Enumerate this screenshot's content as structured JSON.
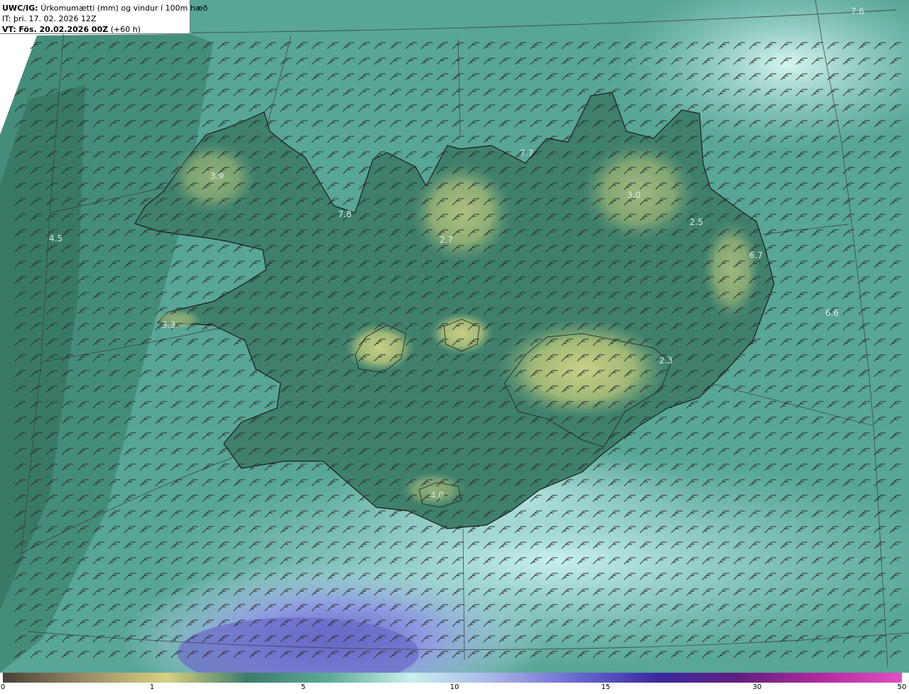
{
  "header": {
    "product": "UWC/IG:",
    "description": "Úrkomumætti (mm) og vindur í 100m hæð",
    "init_time": "IT: þri. 17. 02. 2026 12Z",
    "valid_prefix": "VT:",
    "valid_time": "Fös. 20.02.2026 00Z",
    "lead": "(+60 h)"
  },
  "map_values": [
    "3.9",
    "4.5",
    "3.3",
    "7.7",
    "7.8",
    "2.7",
    "3.0",
    "2.5",
    "6.7",
    "6.6",
    "2.3",
    "4.0",
    "7.6"
  ],
  "colorbar": {
    "ticks": [
      "0",
      "1",
      "5",
      "10",
      "15",
      "30",
      "50"
    ],
    "colors": [
      "#4a4038",
      "#9a8a64",
      "#d7d182",
      "#3c7a6a",
      "#5faa9a",
      "#c8f0ee",
      "#a8b4e8",
      "#6a6ad0",
      "#3a2aa0",
      "#602080",
      "#b02aa0",
      "#e050c0"
    ]
  },
  "colors": {
    "sea_base": "#5aa898",
    "land": "#3e7c68",
    "highland": "#b7c47a",
    "coast": "#1a1a1a",
    "graticule": "#3a3a3a",
    "barbs": "#2e2e2e"
  }
}
